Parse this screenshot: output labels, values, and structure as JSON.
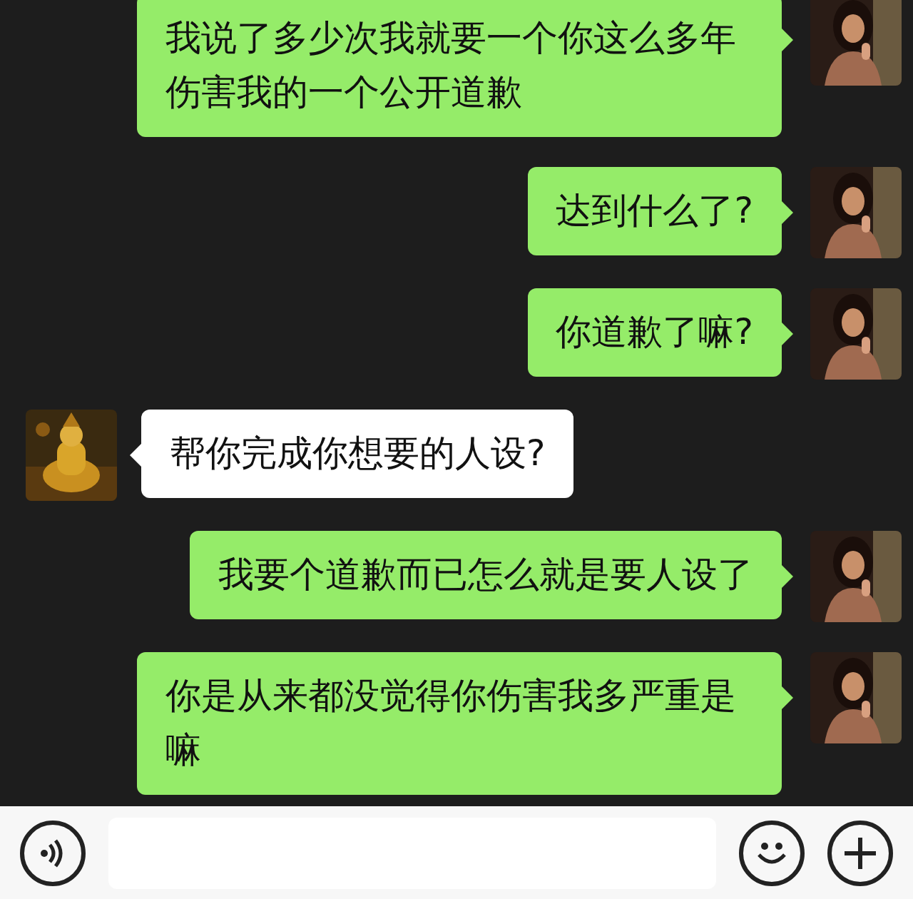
{
  "messages": [
    {
      "kind": "sent",
      "text": "我说了多少次我就要一个你这么多年伤害我的一个公开道歉"
    },
    {
      "kind": "sent",
      "text": "达到什么了?"
    },
    {
      "kind": "sent",
      "text": "你道歉了嘛?"
    },
    {
      "kind": "received",
      "text": "帮你完成你想要的人设?"
    },
    {
      "kind": "sent",
      "text": "我要个道歉而已怎么就是要人设了"
    },
    {
      "kind": "sent",
      "text": "你是从来都没觉得你伤害我多严重是嘛"
    }
  ]
}
